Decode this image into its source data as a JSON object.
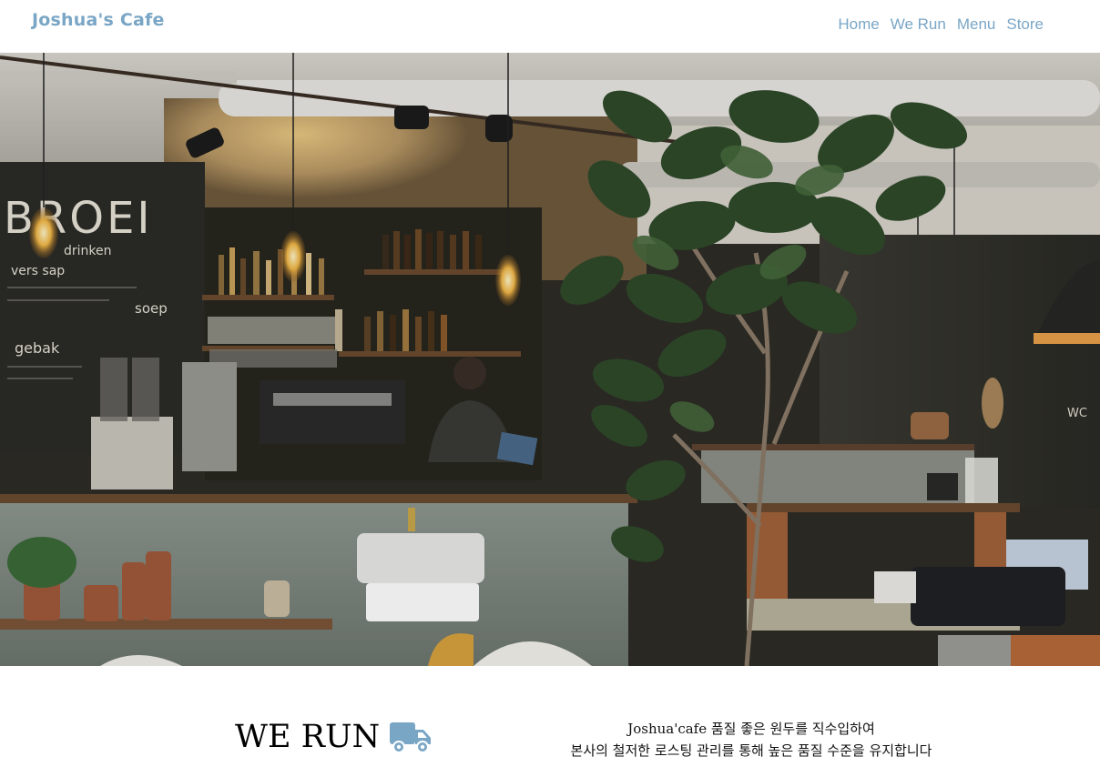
{
  "nav": {
    "brand": "Joshua's Cafe",
    "links": [
      "Home",
      "We Run",
      "Menu",
      "Store"
    ]
  },
  "hero": {
    "image_description_icon": "cafe-interior-photo",
    "chalkboard_text": [
      "BROEI",
      "drinken",
      "vers sap",
      "soep",
      "gebak",
      "WC"
    ]
  },
  "we_run": {
    "title": "WE RUN",
    "icon": "truck-icon",
    "description_lines": [
      "Joshua'cafe 품질 좋은 원두를 직수입하여",
      "본사의 철저한 로스팅 관리를 통해 높은 품질 수준을 유지합니다"
    ]
  },
  "colors": {
    "accent": "#7aa6c6",
    "truck": "#7aa6c6"
  }
}
